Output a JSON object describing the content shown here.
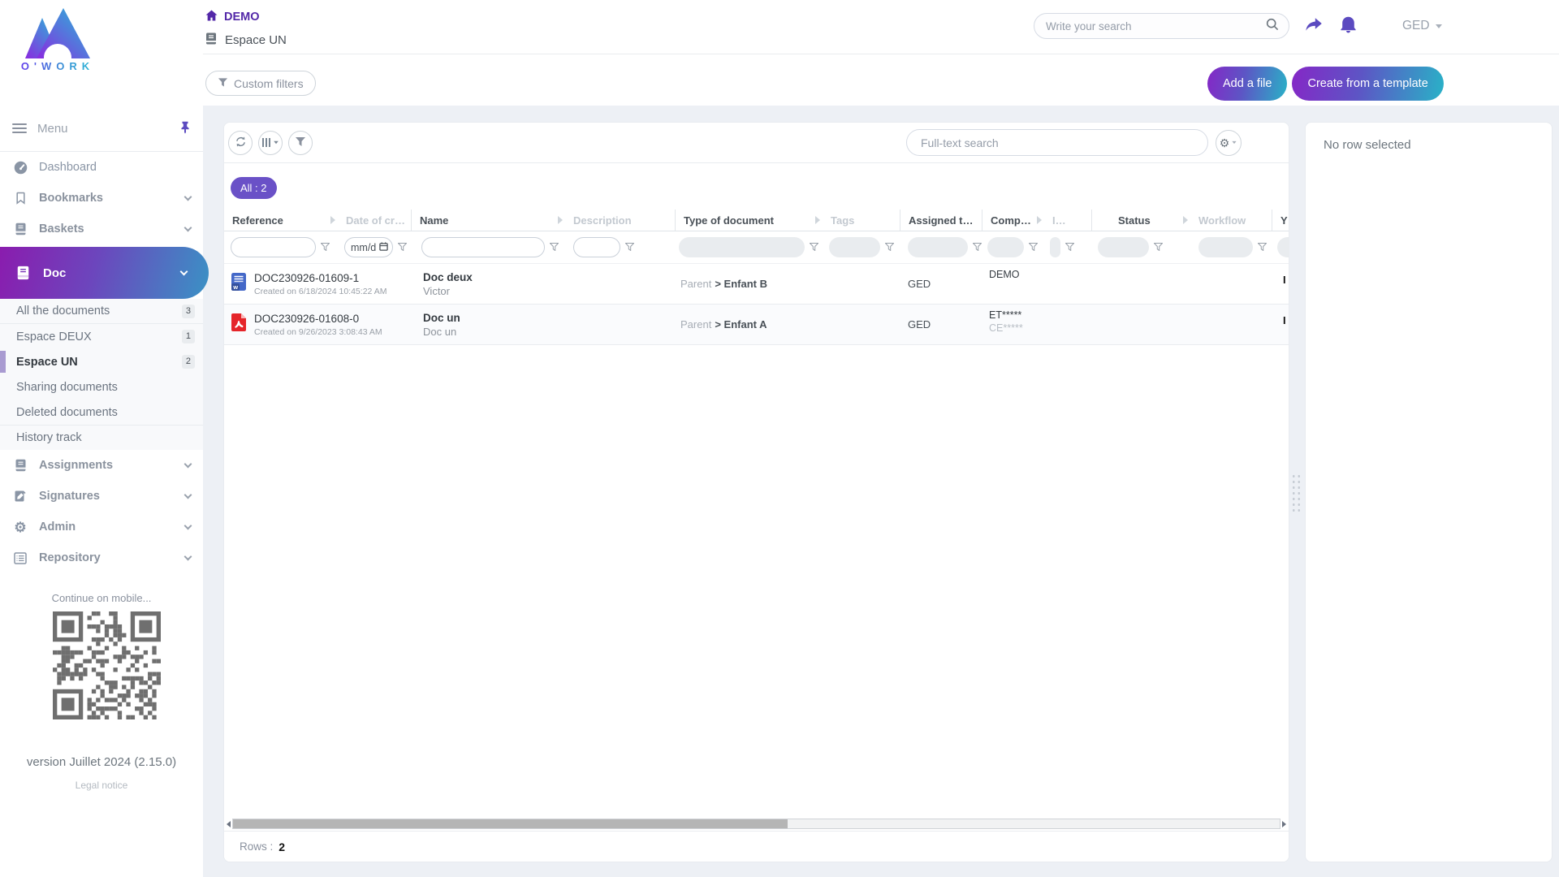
{
  "brand": {
    "logo_text": "O'WORK"
  },
  "header": {
    "breadcrumb_root": "DEMO",
    "breadcrumb_space": "Espace UN",
    "search_placeholder": "Write your search",
    "user_label": "GED",
    "custom_filters_label": "Custom filters",
    "add_file_label": "Add a file",
    "create_template_label": "Create from a template"
  },
  "sidebar": {
    "menu_label": "Menu",
    "nav_top": [
      {
        "label": "Dashboard"
      },
      {
        "label": "Bookmarks"
      },
      {
        "label": "Baskets"
      }
    ],
    "doc": {
      "label": "Doc"
    },
    "doc_children": [
      {
        "label": "All the documents",
        "count": "3"
      },
      {
        "label": "Espace DEUX",
        "count": "1"
      },
      {
        "label": "Espace UN",
        "count": "2"
      },
      {
        "label": "Sharing documents",
        "count": ""
      },
      {
        "label": "Deleted documents",
        "count": ""
      },
      {
        "label": "History track",
        "count": ""
      }
    ],
    "nav_bottom": [
      {
        "label": "Assignments"
      },
      {
        "label": "Signatures"
      },
      {
        "label": "Admin"
      },
      {
        "label": "Repository"
      }
    ],
    "mobile_hint": "Continue on mobile...",
    "version": "version Juillet 2024 (2.15.0)",
    "legal_notice": "Legal notice"
  },
  "table": {
    "fulltext_placeholder": "Full-text search",
    "filter_badge": "All : 2",
    "date_placeholder": "mm/d",
    "path_separator": ">",
    "columns": [
      {
        "label": "Reference"
      },
      {
        "label": "Date of cr…"
      },
      {
        "label": "Name"
      },
      {
        "label": "Description"
      },
      {
        "label": "Type of document"
      },
      {
        "label": "Tags"
      },
      {
        "label": "Assigned t…"
      },
      {
        "label": "Comp…"
      },
      {
        "label": "I…"
      },
      {
        "label": "Status"
      },
      {
        "label": "Workflow"
      },
      {
        "label": "Y…"
      }
    ],
    "rows": [
      {
        "file_type": "word",
        "reference": "DOC230926-01609-1",
        "created": "Created on 6/18/2024 10:45:22 AM",
        "name": "Doc deux",
        "subtitle": "Victor",
        "doc_type_parent": "Parent",
        "doc_type_child": "Enfant B",
        "assigned_to": "GED",
        "company_line1": "DEMO",
        "company_line2": "",
        "edge_text": "I"
      },
      {
        "file_type": "pdf",
        "reference": "DOC230926-01608-0",
        "created": "Created on 9/26/2023 3:08:43 AM",
        "name": "Doc un",
        "subtitle": "Doc un",
        "doc_type_parent": "Parent",
        "doc_type_child": "Enfant A",
        "assigned_to": "GED",
        "company_line1": "ET*****",
        "company_line2": "CE*****",
        "edge_text": "I"
      }
    ],
    "rows_label": "Rows :",
    "rows_count": "2"
  },
  "details_panel": {
    "empty_text": "No row selected"
  }
}
